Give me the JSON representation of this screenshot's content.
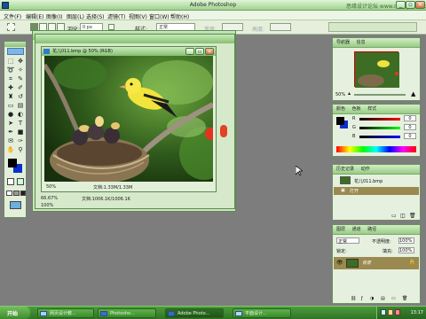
{
  "window": {
    "title": "Adobe Photoshop"
  },
  "watermark": "思缘设计论坛 www.missyuan.com",
  "menu": [
    "文件(F)",
    "编辑(E)",
    "图像(I)",
    "图层(L)",
    "选择(S)",
    "滤镜(T)",
    "视图(V)",
    "窗口(W)",
    "帮助(H)"
  ],
  "options": {
    "feather_label": "羽化:",
    "feather_value": "0 px",
    "style_label": "样式:",
    "style_value": "正常",
    "width_label": "宽度:",
    "height_label": "高度:"
  },
  "documents": {
    "front": {
      "title": "花儿011.bmp @ 50% (RGB)",
      "zoom": "50%",
      "status": "文档:1.33M/1.33M"
    },
    "back": {
      "zoom": "66.67%",
      "status": "文档:1006.1K/1006.1K",
      "zoom2": "100%"
    }
  },
  "panels": {
    "navigator": {
      "tabs": [
        "导航器",
        "信息"
      ],
      "zoom": "50%"
    },
    "color": {
      "tabs": [
        "颜色",
        "色板",
        "样式"
      ],
      "labels": [
        "R",
        "G",
        "B"
      ],
      "values": [
        "0",
        "0",
        "0"
      ]
    },
    "history": {
      "tabs": [
        "历史记录",
        "动作"
      ],
      "items": [
        "花儿011.bmp",
        "打开"
      ]
    },
    "layers": {
      "tabs": [
        "图层",
        "通道",
        "路径"
      ],
      "mode": "正常",
      "opacity_label": "不透明度:",
      "opacity": "100%",
      "lock_label": "锁定:",
      "fill_label": "填充:",
      "fill": "100%",
      "layer_name": "背景"
    }
  },
  "taskbar": {
    "start": "开始",
    "tasks": [
      "网页设计教...",
      "Photosho...",
      "Adobe Photo...",
      "平面设计..."
    ],
    "clock": "13:17"
  },
  "colors": {
    "accent": "#7fbf6b",
    "history_highlight": "#9a8a4f",
    "layer_highlight": "#9a8a4f",
    "fg": "#000000",
    "bg": "#0a2fcf"
  }
}
